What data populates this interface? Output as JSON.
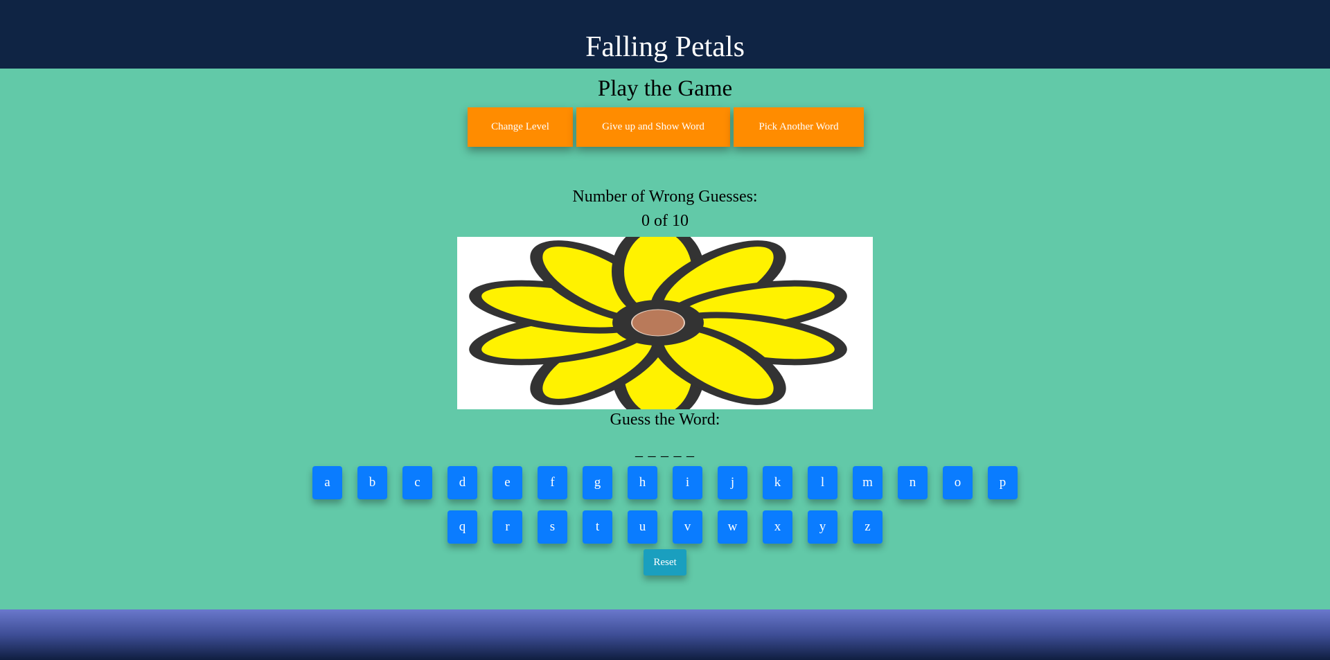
{
  "header": {
    "title": "Falling Petals"
  },
  "game": {
    "subtitle": "Play the Game",
    "controls": {
      "change_level": "Change Level",
      "give_up": "Give up and Show Word",
      "pick_another": "Pick Another Word"
    },
    "wrong_guesses_label": "Number of Wrong Guesses:",
    "wrong_guesses_value": "0 of 10",
    "guess_label": "Guess the Word:",
    "word_blanks": "_ _ _ _ _",
    "letters_row1": [
      "a",
      "b",
      "c",
      "d",
      "e",
      "f",
      "g",
      "h",
      "i",
      "j",
      "k",
      "l",
      "m",
      "n",
      "o",
      "p"
    ],
    "letters_row2": [
      "q",
      "r",
      "s",
      "t",
      "u",
      "v",
      "w",
      "x",
      "y",
      "z"
    ],
    "reset_label": "Reset",
    "flower_petal_count": 10
  },
  "colors": {
    "header_bg": "#0f2444",
    "page_bg": "#62c9a8",
    "control_button": "#ff8c00",
    "letter_button": "#0a7cff",
    "reset_button": "#1a9fbf",
    "petal": "#fff200",
    "flower_center": "#b97a5a"
  }
}
